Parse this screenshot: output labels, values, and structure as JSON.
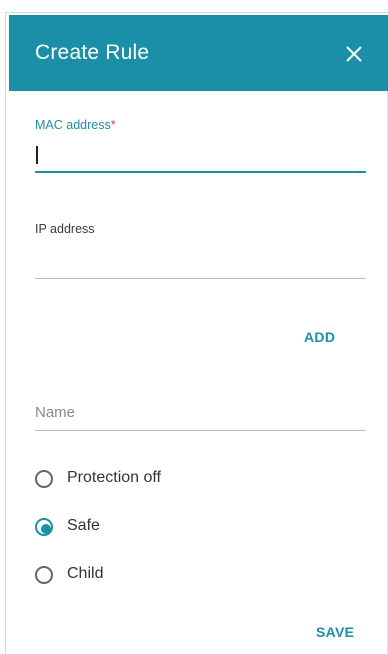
{
  "dialog": {
    "title": "Create Rule",
    "close_icon": "close-icon",
    "accent_color": "#1b8fa8"
  },
  "form": {
    "mac": {
      "label": "MAC address",
      "required_mark": "*",
      "value": ""
    },
    "ip": {
      "label": "IP address",
      "value": ""
    },
    "add_label": "ADD",
    "name": {
      "placeholder": "Name",
      "value": ""
    },
    "protection": {
      "options": [
        {
          "label": "Protection off",
          "selected": false
        },
        {
          "label": "Safe",
          "selected": true
        },
        {
          "label": "Child",
          "selected": false
        }
      ]
    },
    "save_label": "SAVE"
  }
}
